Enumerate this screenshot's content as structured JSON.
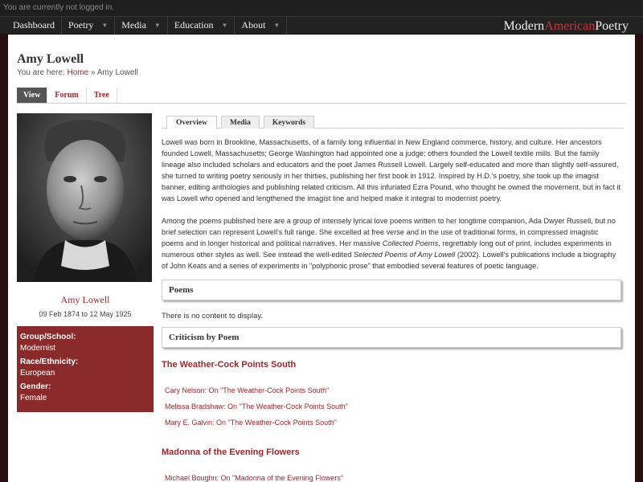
{
  "topbar": {
    "status": "You are currently not logged in."
  },
  "nav": {
    "items": [
      {
        "label": "Dashboard",
        "has_arrow": false
      },
      {
        "label": "Poetry",
        "has_arrow": true
      },
      {
        "label": "Media",
        "has_arrow": true
      },
      {
        "label": "Education",
        "has_arrow": true
      },
      {
        "label": "About",
        "has_arrow": true
      }
    ],
    "brand": {
      "part1": "Modern",
      "part2": "American",
      "part3": "Poetry"
    }
  },
  "page": {
    "title": "Amy Lowell",
    "breadcrumb": {
      "prefix": "You are here:",
      "home": "Home",
      "sep": "»",
      "current": "Amy Lowell"
    },
    "tabs": [
      "View",
      "Forum",
      "Tree"
    ]
  },
  "sidebar": {
    "name": "Amy Lowell",
    "dates": "09 Feb 1874 to 12 May 1925",
    "info": [
      {
        "label": "Group/School:",
        "value": "Modernist"
      },
      {
        "label": "Race/Ethnicity:",
        "value": "European"
      },
      {
        "label": "Gender:",
        "value": "Female"
      }
    ]
  },
  "content": {
    "tabs": [
      "Overview",
      "Media",
      "Keywords"
    ],
    "para1": "Lowell was born in Brookline, Massachusetts, of a family long influential in New England commerce, history, and culture. Her ancestors founded Lowell, Massachusetts; George Washington had appointed one a judge; others founded the Lowell textile mills. But the family lineage also included scholars and educators and the poet James Russell Lowell. Largely self-educated and more than slightly self-assured, she turned to writing poetry seriously in her thirties, publishing her first book in 1912. Inspired by H.D.'s poetry, she took up the imagist banner, editing anthologies and publishing related criticism. All this infuriated Ezra Pound, who thought he owned the movement, but in fact it was Lowell who opened and lengthened the imagist line and helped make it integral to modernist poetry.",
    "para2_a": "Among the poems published here are a group of intensely lyrical love poems written to her longtime companion, Ada Dwyer Russell, but no brief selection can represent Lowell's full range. She excelled at free verse and in the use of traditional forms, in compressed imagistic poems and in longer historical and political narratives. Her massive ",
    "para2_b": "Collected Poems",
    "para2_c": ", regrettably long out of print, includes experiments in numerous other styles as well. See instead the well-edited ",
    "para2_d": "Selected Poems of Amy Lowell",
    "para2_e": " (2002). Lowell's publications include a biography of John Keats and a series of experiments in \"polyphonic prose\" that embodied several features of poetic language.",
    "poems_heading": "Poems",
    "no_content": "There is no content to display.",
    "criticism_heading": "Criticism by Poem",
    "poems": [
      {
        "title": "The Weather-Cock Points South",
        "links": [
          "Cary Nelson: On \"The Weather-Cock Points South\"",
          "Melissa Bradshaw: On \"The Weather-Cock Points South\"",
          "Mary E. Galvin: On \"The Weather-Cock Points South\""
        ]
      },
      {
        "title": "Madonna of the Evening Flowers",
        "links": [
          "Michael Boughn: On \"Madonna of the Evening Flowers\""
        ]
      }
    ]
  }
}
